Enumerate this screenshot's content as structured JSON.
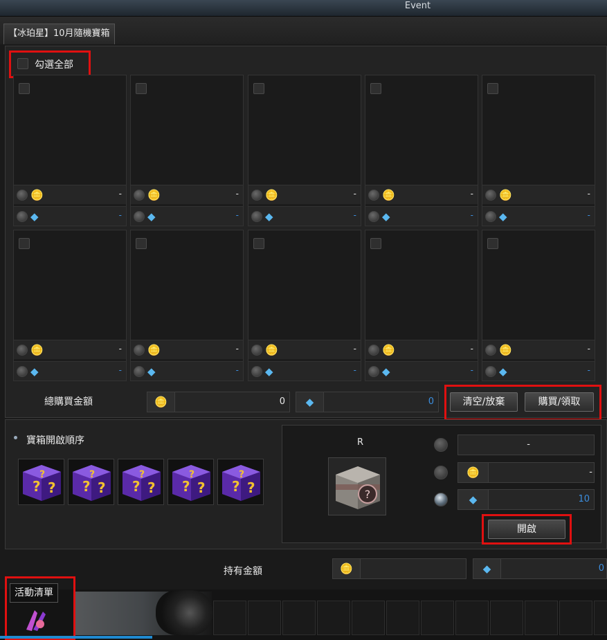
{
  "window": {
    "title": "Event"
  },
  "tab": {
    "label": "【冰珀星】10月隨機寶箱"
  },
  "select_all": {
    "label": "勾選全部"
  },
  "cards": [
    {
      "gold": "-",
      "gem": "-"
    },
    {
      "gold": "-",
      "gem": "-"
    },
    {
      "gold": "-",
      "gem": "-"
    },
    {
      "gold": "-",
      "gem": "-"
    },
    {
      "gold": "-",
      "gem": "-"
    },
    {
      "gold": "-",
      "gem": "-"
    },
    {
      "gold": "-",
      "gem": "-"
    },
    {
      "gold": "-",
      "gem": "-"
    },
    {
      "gold": "-",
      "gem": "-"
    },
    {
      "gold": "-",
      "gem": "-"
    }
  ],
  "icons": {
    "gold": "gold-coin-icon",
    "gem": "diamond-gem-icon"
  },
  "total": {
    "label": "總購買金額",
    "gold_value": "0",
    "gem_value": "0"
  },
  "buttons": {
    "clear": "清空/放棄",
    "buy": "購買/領取",
    "open": "開啟"
  },
  "order": {
    "label": "寶箱開啟順序",
    "boxes_count": 5
  },
  "open_panel": {
    "rank": "R",
    "name_value": "-",
    "gold_value": "-",
    "gem_value": "10"
  },
  "held": {
    "label": "持有金額",
    "gold_value": "",
    "gem_value": "0"
  },
  "activity": {
    "label": "活動清單"
  },
  "colors": {
    "highlight": "#e01010",
    "gem_text": "#3c8fe0",
    "gold": "#e3b233"
  }
}
